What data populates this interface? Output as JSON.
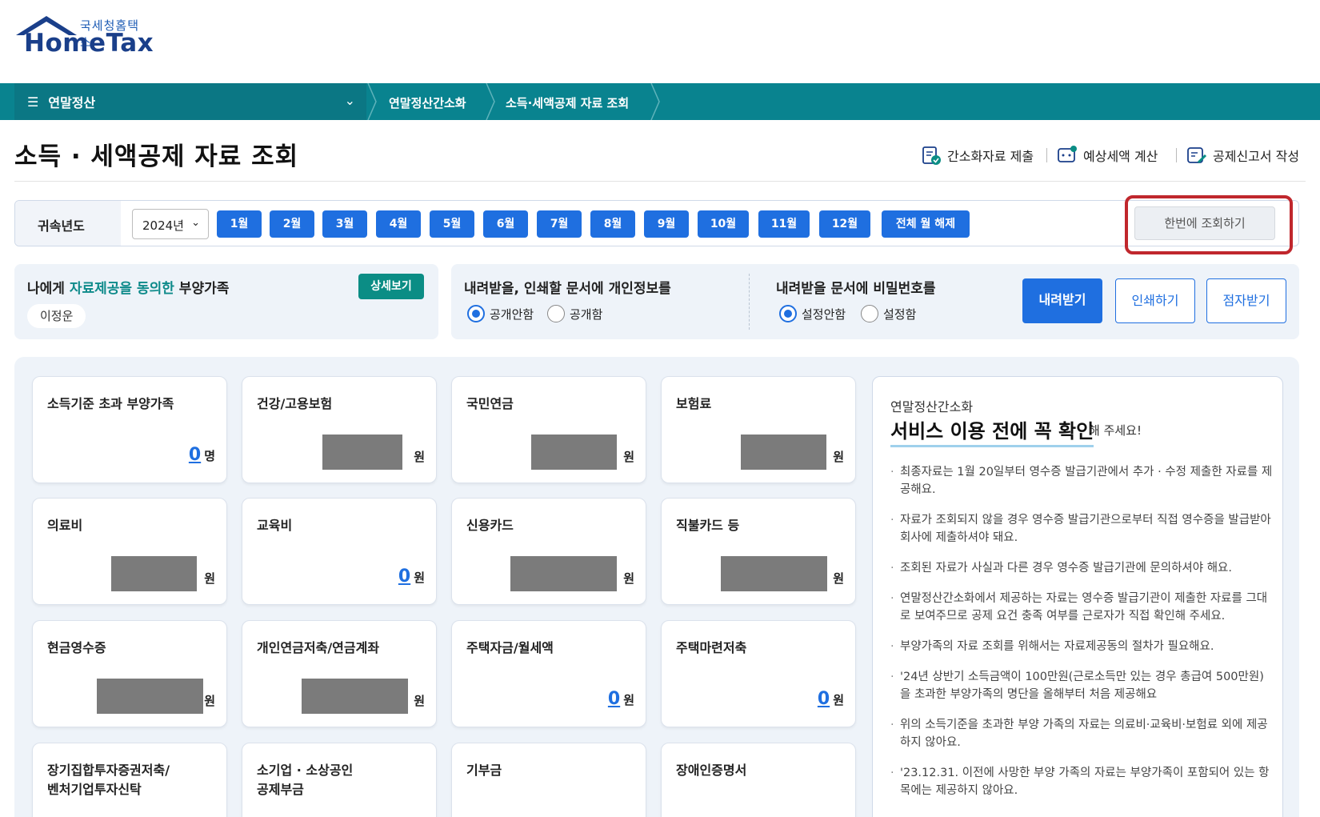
{
  "logo": {
    "small": "국세청홈택스",
    "big": "HomeTax"
  },
  "nav": {
    "menu_label": "연말정산",
    "crumbs": [
      "연말정산간소화",
      "소득·세액공제 자료 조회"
    ]
  },
  "page_title": "소득 · 세액공제 자료 조회",
  "quick_actions": [
    "간소화자료 제출",
    "예상세액 계산",
    "공제신고서 작성"
  ],
  "year_bar": {
    "label": "귀속년도",
    "year_value": "2024년",
    "months": [
      "1월",
      "2월",
      "3월",
      "4월",
      "5월",
      "6월",
      "7월",
      "8월",
      "9월",
      "10월",
      "11월",
      "12월",
      "전체 월 해제"
    ],
    "search_all": "한번에 조회하기"
  },
  "dependents": {
    "title_before": "나에게 ",
    "title_highlight": "자료제공을 동의한",
    "title_after": " 부양가족",
    "detail_button": "상세보기",
    "name": "이정운"
  },
  "privacy": {
    "title": "내려받을, 인쇄할 문서에 개인정보를",
    "options": [
      "공개안함",
      "공개함"
    ],
    "selected": "공개안함"
  },
  "password": {
    "title": "내려받을 문서에 비밀번호를",
    "options": [
      "설정안함",
      "설정함"
    ],
    "selected": "설정안함"
  },
  "actions": {
    "download": "내려받기",
    "print": "인쇄하기",
    "braille": "점자받기"
  },
  "cards": [
    {
      "title": "소득기준 초과 부양가족",
      "value": "0",
      "unit": "명",
      "masked": false
    },
    {
      "title": "건강/고용보험",
      "value": "",
      "unit": "원",
      "masked": true
    },
    {
      "title": "국민연금",
      "value": "",
      "unit": "원",
      "masked": true
    },
    {
      "title": "보험료",
      "value": "",
      "unit": "원",
      "masked": true
    },
    {
      "title": "의료비",
      "value": "",
      "unit": "원",
      "masked": true
    },
    {
      "title": "교육비",
      "value": "0",
      "unit": "원",
      "masked": false
    },
    {
      "title": "신용카드",
      "value": "",
      "unit": "원",
      "masked": true
    },
    {
      "title": "직불카드 등",
      "value": "",
      "unit": "원",
      "masked": true
    },
    {
      "title": "현금영수증",
      "value": "",
      "unit": "원",
      "masked": true
    },
    {
      "title": "개인연금저축/연금계좌",
      "value": "",
      "unit": "원",
      "masked": true
    },
    {
      "title": "주택자금/월세액",
      "value": "0",
      "unit": "원",
      "masked": false
    },
    {
      "title": "주택마련저축",
      "value": "0",
      "unit": "원",
      "masked": false
    },
    {
      "title": "장기집합투자증권저축/\n벤처기업투자신탁",
      "value": "",
      "unit": "",
      "masked": false
    },
    {
      "title": "소기업 · 소상공인\n공제부금",
      "value": "",
      "unit": "",
      "masked": false
    },
    {
      "title": "기부금",
      "value": "",
      "unit": "",
      "masked": false
    },
    {
      "title": "장애인증명서",
      "value": "",
      "unit": "",
      "masked": false
    }
  ],
  "notice": {
    "line1": "연말정산간소화",
    "line2": "서비스 이용 전에 꼭 확인",
    "line3": "해 주세요!",
    "items": [
      "최종자료는 1월 20일부터 영수증 발급기관에서 추가 · 수정 제출한 자료를 제공해요.",
      "자료가 조회되지 않을 경우 영수증 발급기관으로부터 직접 영수증을 발급받아 회사에 제출하셔야 돼요.",
      "조회된 자료가 사실과 다른 경우 영수증 발급기관에 문의하셔야 해요.",
      "연말정산간소화에서 제공하는 자료는 영수증 발급기관이 제출한 자료를 그대로 보여주므로 공제 요건 충족 여부를 근로자가 직접 확인해 주세요.",
      "부양가족의 자료 조회를 위해서는 자료제공동의 절차가 필요해요.",
      "'24년 상반기 소득금액이 100만원(근로소득만 있는 경우 총급여 500만원)을 초과한 부양가족의 명단을 올해부터 처음 제공해요",
      "위의 소득기준을 초과한 부양 가족의 자료는 의료비·교육비·보험료 외에 제공하지 않아요.",
      "'23.12.31. 이전에 사망한 부양 가족의 자료는 부양가족이 포함되어 있는 항목에는 제공하지 않아요."
    ]
  },
  "colors": {
    "nav": "#09838f",
    "primary": "#1f6fe0",
    "teal_button": "#0b8d85",
    "highlight_box": "#c0272d"
  }
}
